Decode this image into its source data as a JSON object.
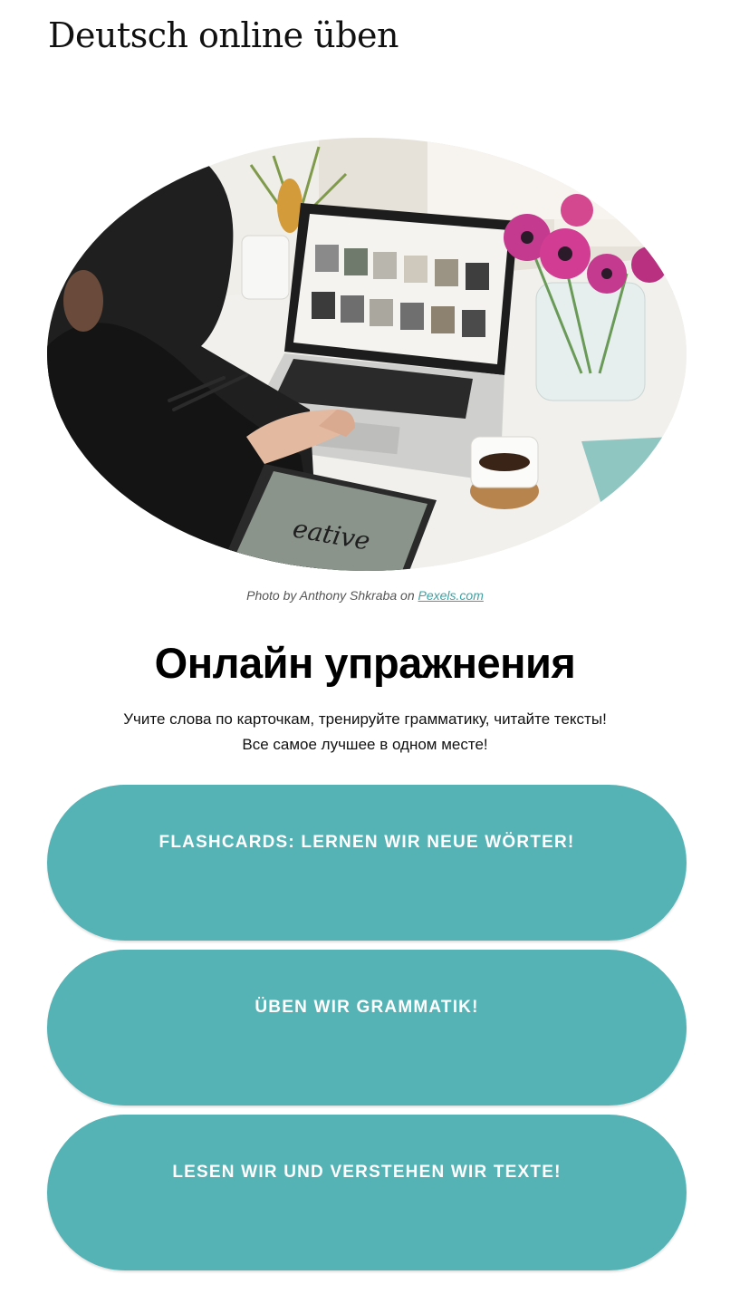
{
  "header": {
    "site_title": "Deutsch online üben"
  },
  "hero": {
    "image_description_icon": "photo-woman-laptop",
    "caption_prefix": "Photo by Anthony Shkraba on ",
    "caption_link": "Pexels.com",
    "screen_text": "eative"
  },
  "main": {
    "heading": "Онлайн упражнения",
    "intro_line_1": "Учите слова по карточкам, тренируйте грамматику, читайте тексты!",
    "intro_line_2": "Все самое лучшее в одном месте!"
  },
  "buttons": [
    {
      "label": "FLASHCARDS: LERNEN WIR NEUE WÖRTER!"
    },
    {
      "label": "ÜBEN WIR GRAMMATIK!"
    },
    {
      "label": "LESEN WIR UND VERSTEHEN WIR TEXTE!"
    }
  ],
  "colors": {
    "accent": "#55b2b5",
    "link": "#3aa3a6"
  }
}
